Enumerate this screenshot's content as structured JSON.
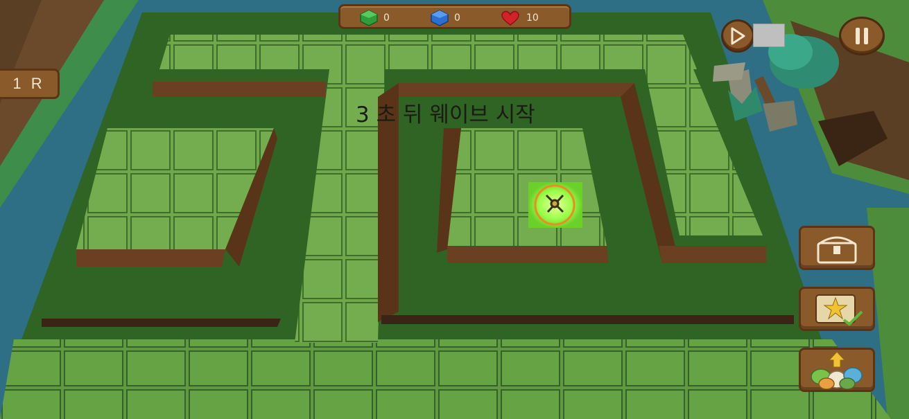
{
  "hud": {
    "resources": [
      {
        "name": "green-gem",
        "value": "0",
        "color": "#2e9e3a"
      },
      {
        "name": "blue-gem",
        "value": "0",
        "color": "#2b6fd1"
      },
      {
        "name": "heart",
        "value": "10",
        "color": "#d2222a"
      }
    ],
    "round_label": "1 R",
    "wave_notice": "3 초 뒤 웨이브 시작"
  },
  "controls": {
    "play_icon": "play-icon",
    "pause_icon": "pause-icon",
    "side_buttons": [
      {
        "name": "chest-button",
        "icon": "treasure-chest-icon"
      },
      {
        "name": "quest-button",
        "icon": "star-map-icon"
      },
      {
        "name": "upgrade-button",
        "icon": "upgrade-eggs-icon"
      }
    ]
  },
  "colors": {
    "water": "#2e6f86",
    "grass_tile": "#6fa84b",
    "hedge_dark": "#2f6425",
    "wood_panel": "#8a5a2b",
    "tower_glow": "#9bff4a"
  }
}
